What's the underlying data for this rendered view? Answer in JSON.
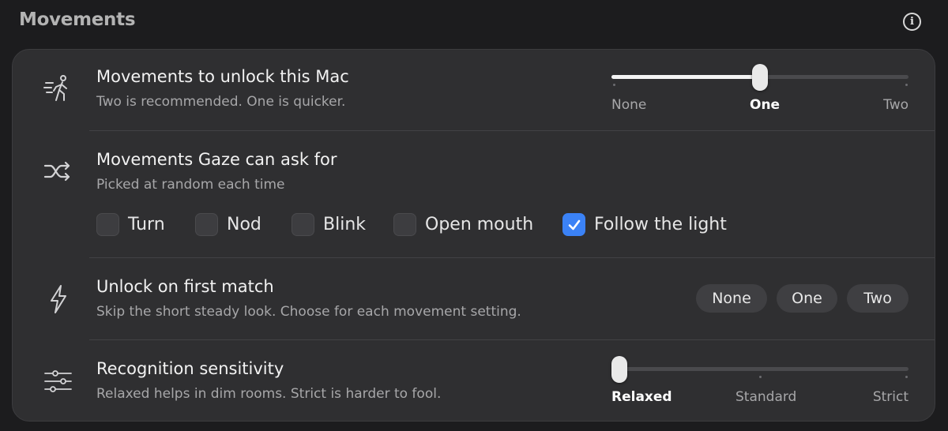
{
  "section": {
    "title": "Movements"
  },
  "rows": {
    "unlock": {
      "title": "Movements to unlock this Mac",
      "subtitle": "Two is recommended. One is quicker.",
      "icon": "person-walking-icon",
      "slider": {
        "options": [
          "None",
          "One",
          "Two"
        ],
        "selected": "One",
        "value_index": 1
      }
    },
    "gaze": {
      "title": "Movements Gaze can ask for",
      "subtitle": "Picked at random each time",
      "icon": "shuffle-icon",
      "options": [
        {
          "label": "Turn",
          "checked": false
        },
        {
          "label": "Nod",
          "checked": false
        },
        {
          "label": "Blink",
          "checked": false
        },
        {
          "label": "Open mouth",
          "checked": false
        },
        {
          "label": "Follow the light",
          "checked": true
        }
      ]
    },
    "first_match": {
      "title": "Unlock on first match",
      "subtitle": "Skip the short steady look. Choose for each movement setting.",
      "icon": "bolt-icon",
      "buttons": [
        "None",
        "One",
        "Two"
      ]
    },
    "sensitivity": {
      "title": "Recognition sensitivity",
      "subtitle": "Relaxed helps in dim rooms. Strict is harder to fool.",
      "icon": "sliders-icon",
      "slider": {
        "options": [
          "Relaxed",
          "Standard",
          "Strict"
        ],
        "selected": "Relaxed",
        "value_index": 0
      }
    }
  },
  "colors": {
    "accent": "#3b82f6",
    "card": "#2f2f31",
    "background": "#1c1c1e"
  }
}
